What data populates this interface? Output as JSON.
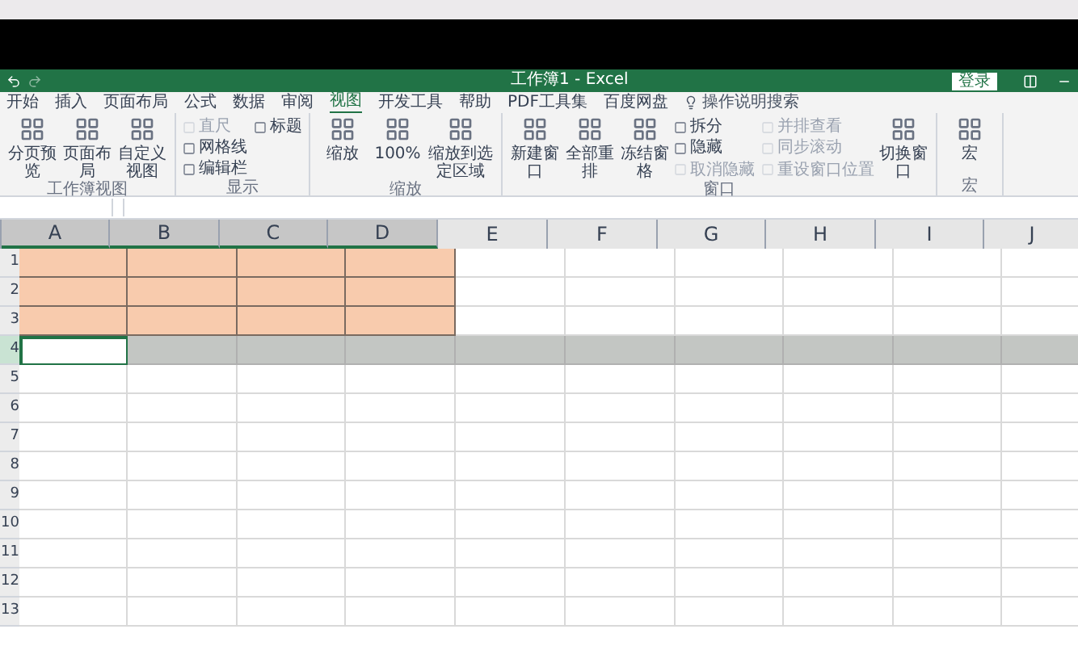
{
  "window": {
    "title": "工作簿1 - Excel",
    "signin": "登录"
  },
  "tabs": [
    {
      "label": "开始",
      "selected": false
    },
    {
      "label": "插入",
      "selected": false
    },
    {
      "label": "页面布局",
      "selected": false
    },
    {
      "label": "公式",
      "selected": false
    },
    {
      "label": "数据",
      "selected": false
    },
    {
      "label": "审阅",
      "selected": false
    },
    {
      "label": "视图",
      "selected": true
    },
    {
      "label": "开发工具",
      "selected": false
    },
    {
      "label": "帮助",
      "selected": false
    },
    {
      "label": "PDF工具集",
      "selected": false
    },
    {
      "label": "百度网盘",
      "selected": false
    }
  ],
  "search": {
    "placeholder": "操作说明搜索"
  },
  "ribbon": [
    {
      "label": "工作簿视图",
      "items": [
        {
          "label": "分页预览",
          "kind": "large",
          "disabled": false
        },
        {
          "label": "页面布局",
          "kind": "large",
          "disabled": false
        },
        {
          "label": "自定义视图",
          "kind": "large",
          "disabled": false
        }
      ]
    },
    {
      "label": "显示",
      "items": [
        {
          "label": "直尺",
          "kind": "small",
          "disabled": true
        },
        {
          "label": "网格线",
          "kind": "small",
          "disabled": false
        },
        {
          "label": "编辑栏",
          "kind": "small",
          "disabled": false
        },
        {
          "label": "标题",
          "kind": "small",
          "disabled": false
        }
      ]
    },
    {
      "label": "缩放",
      "items": [
        {
          "label": "缩放",
          "kind": "large",
          "disabled": false
        },
        {
          "label": "100%",
          "kind": "large",
          "disabled": false
        },
        {
          "label": "缩放到选定区域",
          "kind": "large",
          "disabled": false
        }
      ]
    },
    {
      "label": "窗口",
      "items": [
        {
          "label": "新建窗口",
          "kind": "large",
          "disabled": false
        },
        {
          "label": "全部重排",
          "kind": "large",
          "disabled": false
        },
        {
          "label": "冻结窗格",
          "kind": "large",
          "disabled": false
        },
        {
          "label": "拆分",
          "kind": "small",
          "disabled": false
        },
        {
          "label": "隐藏",
          "kind": "small",
          "disabled": false
        },
        {
          "label": "取消隐藏",
          "kind": "small",
          "disabled": true
        },
        {
          "label": "并排查看",
          "kind": "small",
          "disabled": true
        },
        {
          "label": "同步滚动",
          "kind": "small",
          "disabled": true
        },
        {
          "label": "重设窗口位置",
          "kind": "small",
          "disabled": true
        },
        {
          "label": "切换窗口",
          "kind": "large",
          "disabled": false
        }
      ]
    },
    {
      "label": "宏",
      "items": [
        {
          "label": "宏",
          "kind": "large",
          "disabled": false
        }
      ]
    }
  ],
  "sheet": {
    "columns": [
      {
        "label": "A",
        "in_range": true
      },
      {
        "label": "B",
        "in_range": true
      },
      {
        "label": "C",
        "in_range": true
      },
      {
        "label": "D",
        "in_range": true
      },
      {
        "label": "E",
        "in_range": false
      },
      {
        "label": "F",
        "in_range": false
      },
      {
        "label": "G",
        "in_range": false
      },
      {
        "label": "H",
        "in_range": false
      },
      {
        "label": "I",
        "in_range": false
      },
      {
        "label": "J",
        "in_range": false
      }
    ],
    "rows": [
      {
        "label": "1",
        "kind": "highlighted"
      },
      {
        "label": "2",
        "kind": "highlighted"
      },
      {
        "label": "3",
        "kind": "highlighted"
      },
      {
        "label": "4",
        "kind": "selected"
      },
      {
        "label": "5",
        "kind": "plain"
      },
      {
        "label": "6",
        "kind": "plain"
      },
      {
        "label": "7",
        "kind": "plain"
      },
      {
        "label": "8",
        "kind": "plain"
      },
      {
        "label": "9",
        "kind": "plain"
      },
      {
        "label": "10",
        "kind": "plain"
      },
      {
        "label": "11",
        "kind": "plain"
      },
      {
        "label": "12",
        "kind": "plain"
      },
      {
        "label": "13",
        "kind": "plain"
      }
    ]
  }
}
